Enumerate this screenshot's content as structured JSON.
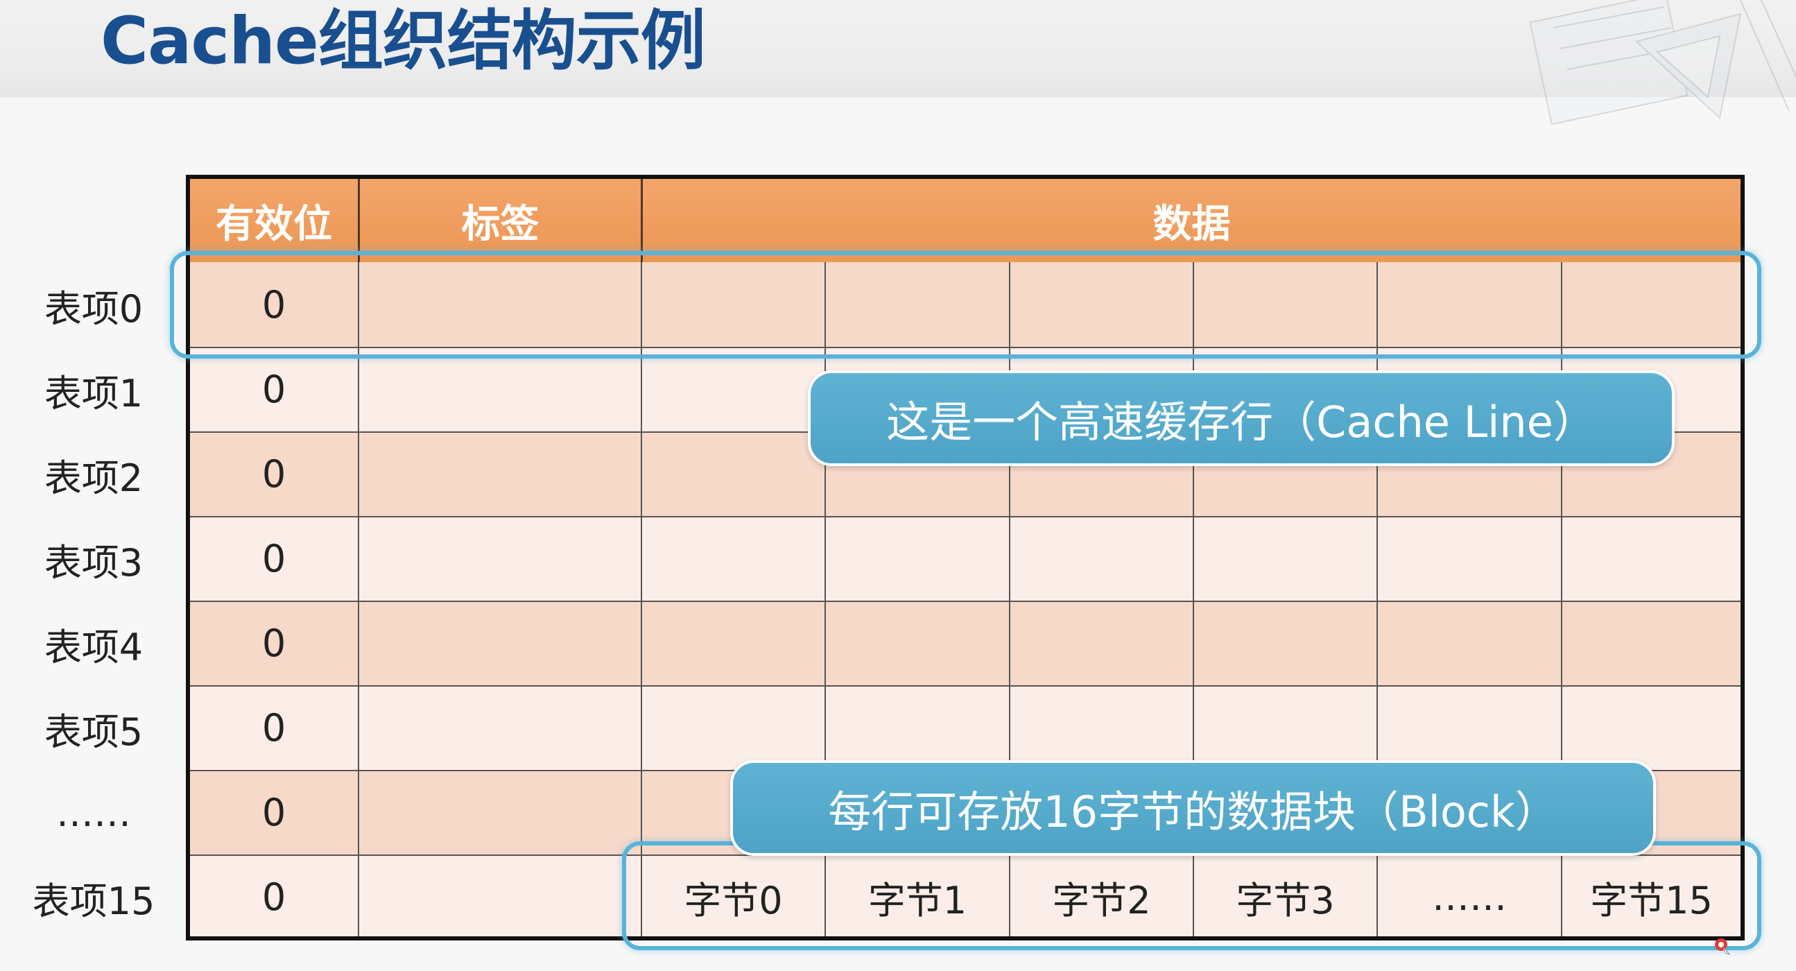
{
  "slide": {
    "title": "Cache组织结构示例"
  },
  "table": {
    "headers": {
      "valid": "有效位",
      "tag": "标签",
      "data": "数据"
    },
    "rows": [
      {
        "label": "表项0",
        "valid": "0"
      },
      {
        "label": "表项1",
        "valid": "0"
      },
      {
        "label": "表项2",
        "valid": "0"
      },
      {
        "label": "表项3",
        "valid": "0"
      },
      {
        "label": "表项4",
        "valid": "0"
      },
      {
        "label": "表项5",
        "valid": "0"
      },
      {
        "label": "……",
        "valid": "0"
      },
      {
        "label": "表项15",
        "valid": "0"
      }
    ],
    "last_row_bytes": [
      "字节0",
      "字节1",
      "字节2",
      "字节3",
      "……",
      "字节15"
    ]
  },
  "callouts": {
    "cache_line": "这是一个高速缓存行（Cache Line）",
    "block": "每行可存放16字节的数据块（Block）"
  },
  "colors": {
    "title": "#1a4f8f",
    "header_orange": "#eb9755",
    "row_dark": "#f7d9ca",
    "row_light": "#fbeee8",
    "highlight_blue": "#58b3d9",
    "callout_blue": "#4ea3c6"
  }
}
